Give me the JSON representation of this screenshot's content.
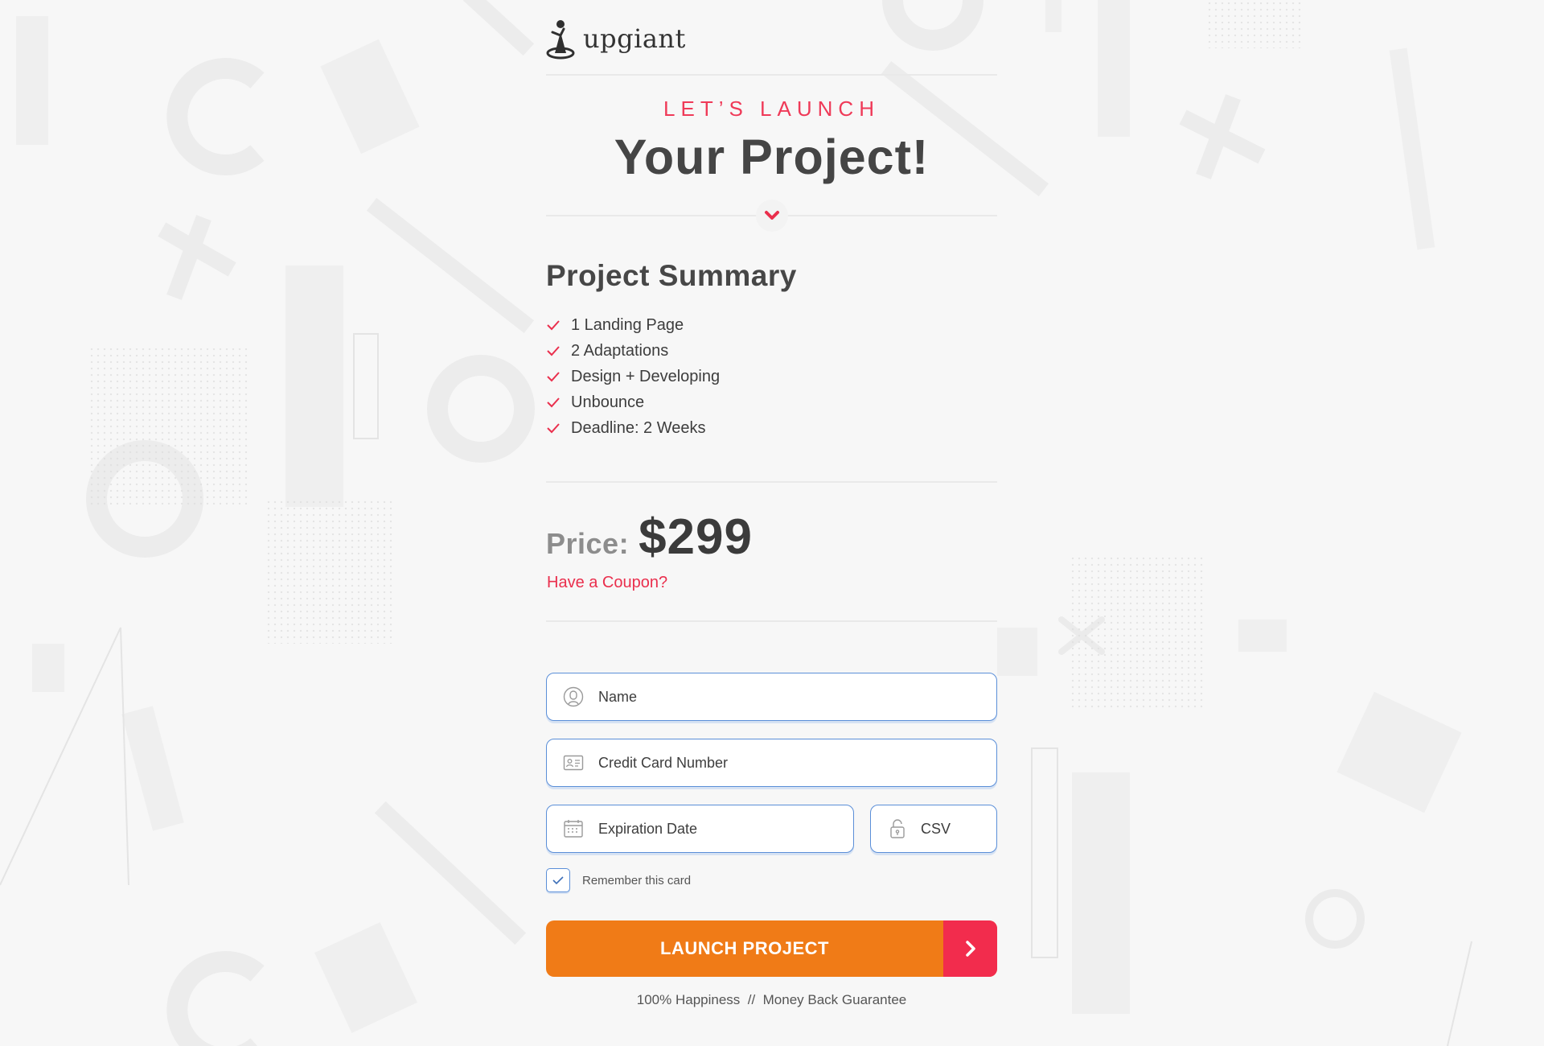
{
  "brand": {
    "name": "upgiant",
    "accent": "#ef3a58",
    "orange": "#f07b17",
    "red": "#f22c4d",
    "field_border": "#5b8fd8"
  },
  "hero": {
    "eyebrow": "LET’S LAUNCH",
    "headline": "Your Project!"
  },
  "summary": {
    "title": "Project Summary",
    "items": [
      "1 Landing Page",
      "2 Adaptations",
      "Design + Developing",
      "Unbounce",
      "Deadline: 2 Weeks"
    ]
  },
  "price": {
    "label": "Price:",
    "value": "$299",
    "coupon_link": "Have a Coupon?"
  },
  "form": {
    "name_placeholder": "Name",
    "card_placeholder": "Credit Card Number",
    "expiry_placeholder": "Expiration Date",
    "csv_placeholder": "CSV",
    "remember_label": "Remember this card",
    "remember_checked": true,
    "submit_label": "LAUNCH PROJECT"
  },
  "footer": {
    "guarantee": "100% Happiness  //  Money Back Guarantee"
  },
  "icons": [
    "logo-mark-icon",
    "chevron-down-icon",
    "check-icon",
    "user-icon",
    "id-card-icon",
    "calendar-icon",
    "lock-icon",
    "chevron-right-icon"
  ]
}
